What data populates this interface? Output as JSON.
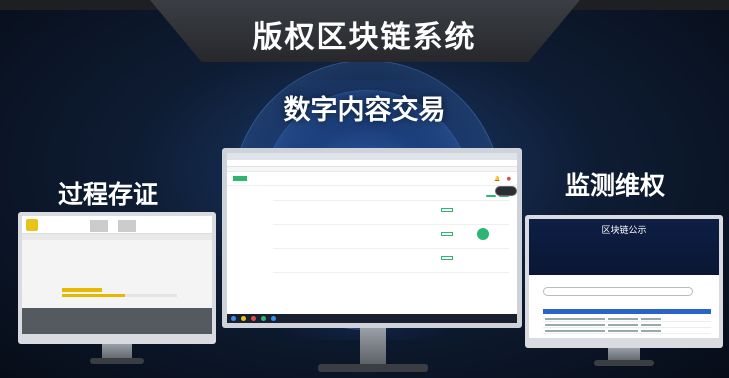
{
  "titles": {
    "main": "版权区块链系统",
    "center": "数字内容交易",
    "left": "过程存证",
    "right": "监测维权"
  },
  "right_screen": {
    "heading": "区块链公示"
  }
}
